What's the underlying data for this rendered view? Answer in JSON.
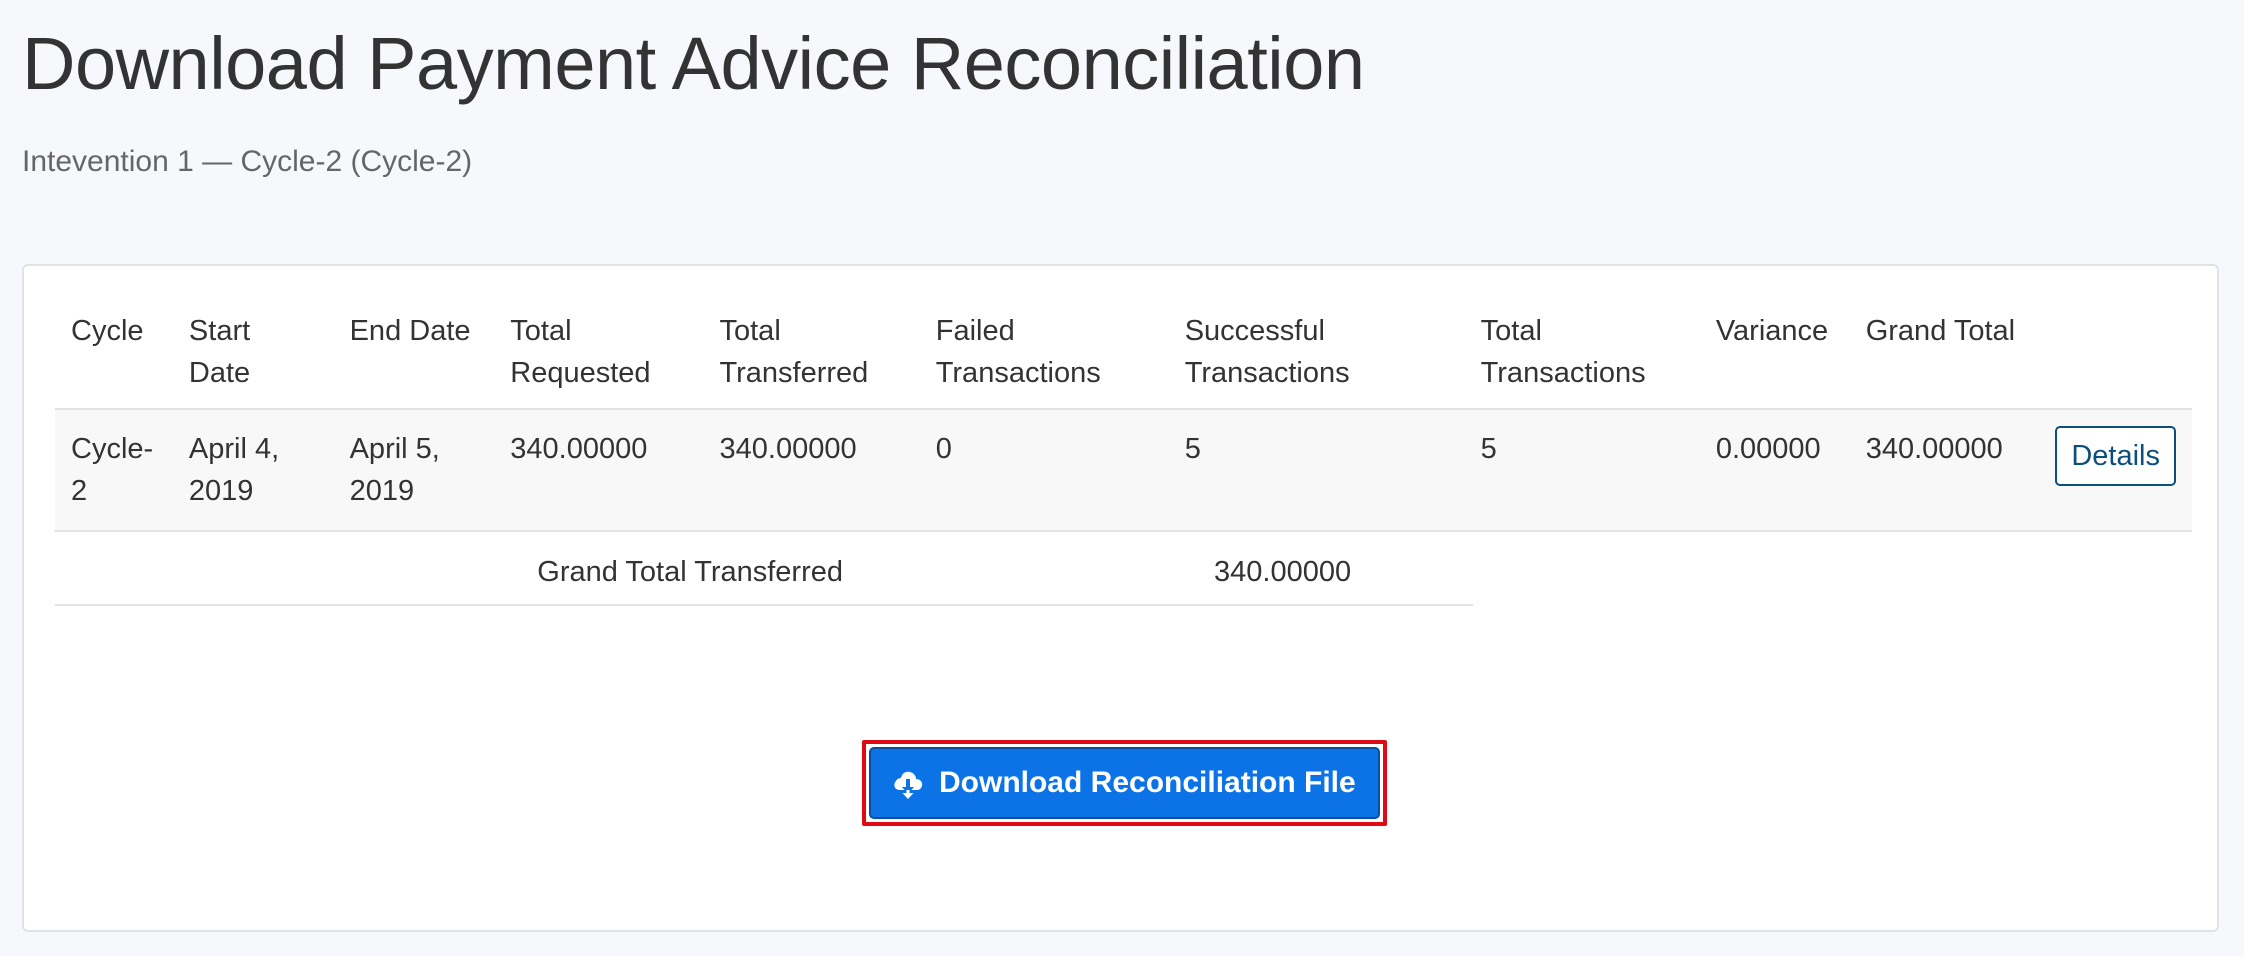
{
  "page": {
    "title": "Download Payment Advice Reconciliation",
    "subtitle": "Intevention 1 — Cycle-2 (Cycle-2)"
  },
  "table": {
    "headers": {
      "cycle": "Cycle",
      "start_date": "Start Date",
      "end_date": "End Date",
      "total_requested": "Total Requested",
      "total_transferred": "Total Transferred",
      "failed_transactions": "Failed Transactions",
      "successful_transactions": "Successful Transactions",
      "total_transactions": "Total Transactions",
      "variance": "Variance",
      "grand_total": "Grand Total"
    },
    "rows": [
      {
        "cycle": "Cycle-2",
        "start_date": "April 4, 2019",
        "end_date": "April 5, 2019",
        "total_requested": "340.00000",
        "total_transferred": "340.00000",
        "failed_transactions": "0",
        "successful_transactions": "5",
        "total_transactions": "5",
        "variance": "0.00000",
        "grand_total": "340.00000",
        "action_label": "Details"
      }
    ],
    "grand_total_transferred": {
      "label": "Grand Total Transferred",
      "value": "340.00000"
    }
  },
  "download": {
    "label": "Download Reconciliation File",
    "icon": "cloud-download-icon"
  },
  "colors": {
    "primary_button": "#0c73e6",
    "highlight_border": "#e00a14",
    "details_border": "#0b4f7d"
  }
}
